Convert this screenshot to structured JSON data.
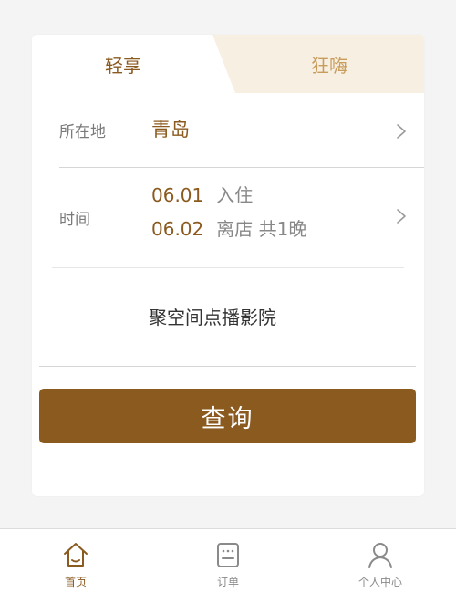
{
  "tabs": [
    {
      "label": "轻享",
      "active": true
    },
    {
      "label": "狂嗨",
      "active": false
    }
  ],
  "location": {
    "label": "所在地",
    "value": "青岛"
  },
  "time": {
    "label": "时间",
    "checkin_date": "06.01",
    "checkin_text": "入住",
    "checkout_date": "06.02",
    "checkout_text": "离店 共1晚"
  },
  "cinema": {
    "name": "聚空间点播影院"
  },
  "search": {
    "label": "查询"
  },
  "bottom_nav": [
    {
      "label": "首页",
      "icon": "home-icon",
      "active": true
    },
    {
      "label": "订单",
      "icon": "order-icon",
      "active": false
    },
    {
      "label": "个人中心",
      "icon": "user-icon",
      "active": false
    }
  ],
  "colors": {
    "accent": "#8b5a1f",
    "tab_inactive_bg": "#f7efe2",
    "tab_inactive_text": "#c89c5a",
    "muted_text": "#888888",
    "nav_inactive": "#8a8a8a"
  }
}
